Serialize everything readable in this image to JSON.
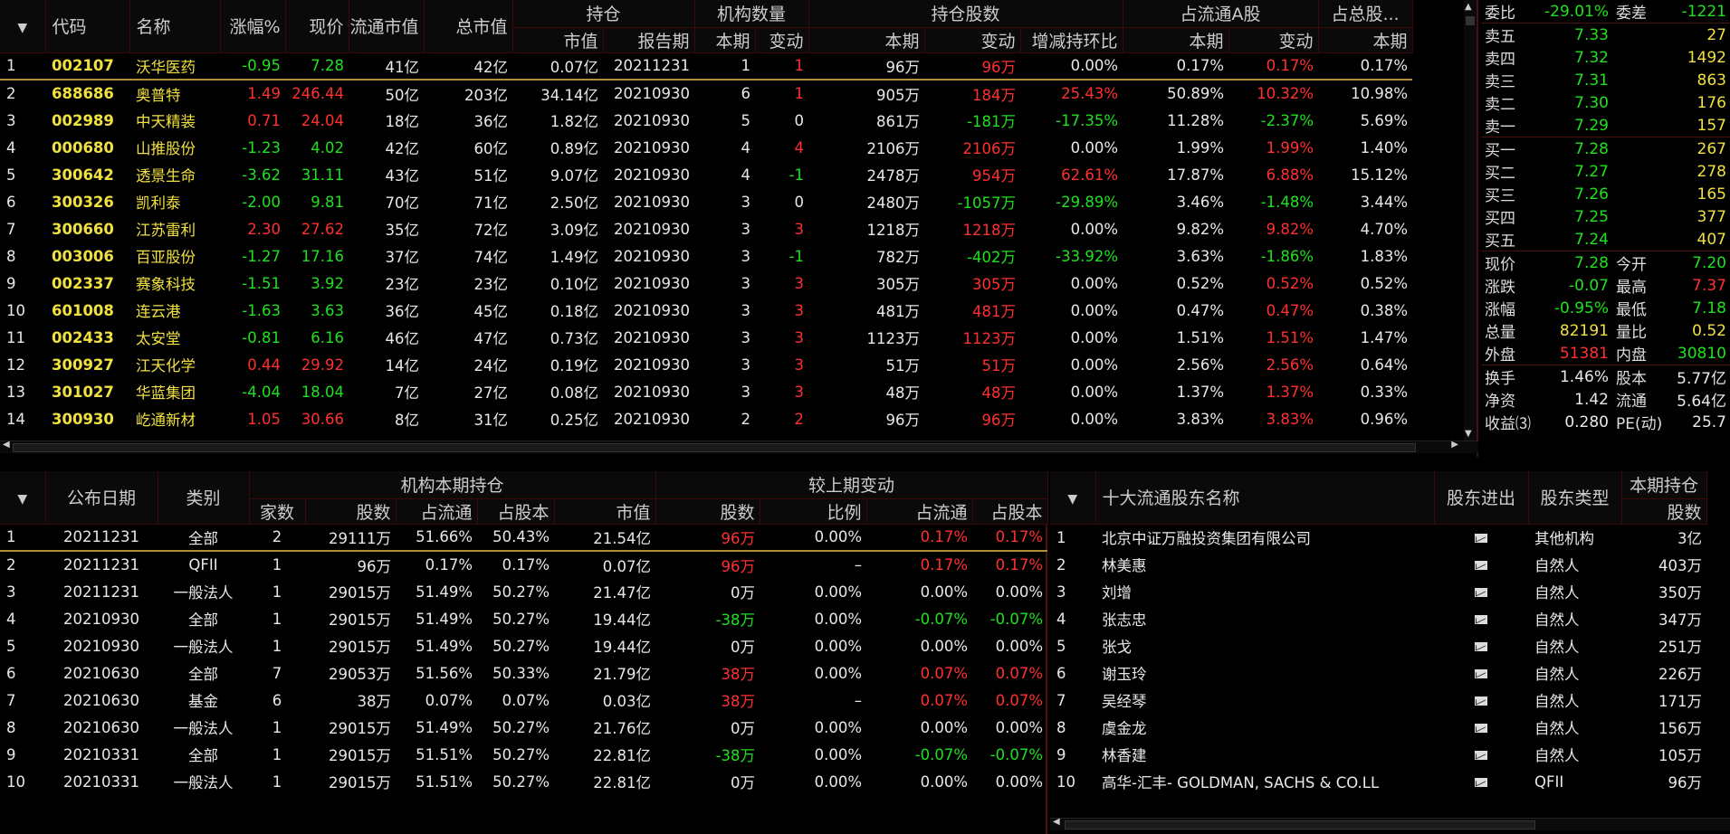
{
  "top": {
    "headers": [
      "代码",
      "名称",
      "涨幅%",
      "现价",
      "流通市值",
      "总市值",
      "持仓",
      "机构数量",
      "持仓股数",
      "占流通A股",
      "占总股..."
    ],
    "subheaders": [
      "市值",
      "报告期",
      "本期",
      "变动",
      "本期",
      "变动",
      "增减持环比",
      "本期",
      "变动",
      "本期"
    ],
    "rows": [
      {
        "n": "1",
        "code": "002107",
        "name": "沃华医药",
        "pct": "-0.95",
        "price": "7.28",
        "flt": "41亿",
        "tot": "42亿",
        "mv": "0.07亿",
        "rpt": "20211231",
        "cnt": "1",
        "chg": "1",
        "sh": "96万",
        "shchg": "96万",
        "qoq": "0.00%",
        "fa": "0.17%",
        "fachg": "0.17%",
        "ta": "0.17%",
        "c": {
          "pct": "g",
          "price": "g",
          "chg": "r",
          "shchg": "r",
          "qoq": "w",
          "fachg": "r"
        }
      },
      {
        "n": "2",
        "code": "688686",
        "name": "奥普特",
        "pct": "1.49",
        "price": "246.44",
        "flt": "50亿",
        "tot": "203亿",
        "mv": "34.14亿",
        "rpt": "20210930",
        "cnt": "6",
        "chg": "1",
        "sh": "905万",
        "shchg": "184万",
        "qoq": "25.43%",
        "fa": "50.89%",
        "fachg": "10.32%",
        "ta": "10.98%",
        "c": {
          "pct": "r",
          "price": "r",
          "chg": "r",
          "shchg": "r",
          "qoq": "r",
          "fachg": "r"
        }
      },
      {
        "n": "3",
        "code": "002989",
        "name": "中天精装",
        "pct": "0.71",
        "price": "24.04",
        "flt": "18亿",
        "tot": "36亿",
        "mv": "1.82亿",
        "rpt": "20210930",
        "cnt": "5",
        "chg": "0",
        "sh": "861万",
        "shchg": "-181万",
        "qoq": "-17.35%",
        "fa": "11.28%",
        "fachg": "-2.37%",
        "ta": "5.69%",
        "c": {
          "pct": "r",
          "price": "r",
          "chg": "w",
          "shchg": "g",
          "qoq": "g",
          "fachg": "g"
        }
      },
      {
        "n": "4",
        "code": "000680",
        "name": "山推股份",
        "pct": "-1.23",
        "price": "4.02",
        "flt": "42亿",
        "tot": "60亿",
        "mv": "0.89亿",
        "rpt": "20210930",
        "cnt": "4",
        "chg": "4",
        "sh": "2106万",
        "shchg": "2106万",
        "qoq": "0.00%",
        "fa": "1.99%",
        "fachg": "1.99%",
        "ta": "1.40%",
        "c": {
          "pct": "g",
          "price": "g",
          "chg": "r",
          "shchg": "r",
          "qoq": "w",
          "fachg": "r"
        }
      },
      {
        "n": "5",
        "code": "300642",
        "name": "透景生命",
        "pct": "-3.62",
        "price": "31.11",
        "flt": "43亿",
        "tot": "51亿",
        "mv": "9.07亿",
        "rpt": "20210930",
        "cnt": "4",
        "chg": "-1",
        "sh": "2478万",
        "shchg": "954万",
        "qoq": "62.61%",
        "fa": "17.87%",
        "fachg": "6.88%",
        "ta": "15.12%",
        "c": {
          "pct": "g",
          "price": "g",
          "chg": "g",
          "shchg": "r",
          "qoq": "r",
          "fachg": "r"
        }
      },
      {
        "n": "6",
        "code": "300326",
        "name": "凯利泰",
        "pct": "-2.00",
        "price": "9.81",
        "flt": "70亿",
        "tot": "71亿",
        "mv": "2.50亿",
        "rpt": "20210930",
        "cnt": "3",
        "chg": "0",
        "sh": "2480万",
        "shchg": "-1057万",
        "qoq": "-29.89%",
        "fa": "3.46%",
        "fachg": "-1.48%",
        "ta": "3.44%",
        "c": {
          "pct": "g",
          "price": "g",
          "chg": "w",
          "shchg": "g",
          "qoq": "g",
          "fachg": "g"
        }
      },
      {
        "n": "7",
        "code": "300660",
        "name": "江苏雷利",
        "pct": "2.30",
        "price": "27.62",
        "flt": "35亿",
        "tot": "72亿",
        "mv": "3.09亿",
        "rpt": "20210930",
        "cnt": "3",
        "chg": "3",
        "sh": "1218万",
        "shchg": "1218万",
        "qoq": "0.00%",
        "fa": "9.82%",
        "fachg": "9.82%",
        "ta": "4.70%",
        "c": {
          "pct": "r",
          "price": "r",
          "chg": "r",
          "shchg": "r",
          "qoq": "w",
          "fachg": "r"
        }
      },
      {
        "n": "8",
        "code": "003006",
        "name": "百亚股份",
        "pct": "-1.27",
        "price": "17.16",
        "flt": "37亿",
        "tot": "74亿",
        "mv": "1.49亿",
        "rpt": "20210930",
        "cnt": "3",
        "chg": "-1",
        "sh": "782万",
        "shchg": "-402万",
        "qoq": "-33.92%",
        "fa": "3.63%",
        "fachg": "-1.86%",
        "ta": "1.83%",
        "c": {
          "pct": "g",
          "price": "g",
          "chg": "g",
          "shchg": "g",
          "qoq": "g",
          "fachg": "g"
        }
      },
      {
        "n": "9",
        "code": "002337",
        "name": "赛象科技",
        "pct": "-1.51",
        "price": "3.92",
        "flt": "23亿",
        "tot": "23亿",
        "mv": "0.10亿",
        "rpt": "20210930",
        "cnt": "3",
        "chg": "3",
        "sh": "305万",
        "shchg": "305万",
        "qoq": "0.00%",
        "fa": "0.52%",
        "fachg": "0.52%",
        "ta": "0.52%",
        "c": {
          "pct": "g",
          "price": "g",
          "chg": "r",
          "shchg": "r",
          "qoq": "w",
          "fachg": "r"
        }
      },
      {
        "n": "10",
        "code": "601008",
        "name": "连云港",
        "pct": "-1.63",
        "price": "3.63",
        "flt": "36亿",
        "tot": "45亿",
        "mv": "0.18亿",
        "rpt": "20210930",
        "cnt": "3",
        "chg": "3",
        "sh": "481万",
        "shchg": "481万",
        "qoq": "0.00%",
        "fa": "0.47%",
        "fachg": "0.47%",
        "ta": "0.38%",
        "c": {
          "pct": "g",
          "price": "g",
          "chg": "r",
          "shchg": "r",
          "qoq": "w",
          "fachg": "r"
        }
      },
      {
        "n": "11",
        "code": "002433",
        "name": "太安堂",
        "pct": "-0.81",
        "price": "6.16",
        "flt": "46亿",
        "tot": "47亿",
        "mv": "0.73亿",
        "rpt": "20210930",
        "cnt": "3",
        "chg": "3",
        "sh": "1123万",
        "shchg": "1123万",
        "qoq": "0.00%",
        "fa": "1.51%",
        "fachg": "1.51%",
        "ta": "1.47%",
        "c": {
          "pct": "g",
          "price": "g",
          "chg": "r",
          "shchg": "r",
          "qoq": "w",
          "fachg": "r"
        }
      },
      {
        "n": "12",
        "code": "300927",
        "name": "江天化学",
        "pct": "0.44",
        "price": "29.92",
        "flt": "14亿",
        "tot": "24亿",
        "mv": "0.19亿",
        "rpt": "20210930",
        "cnt": "3",
        "chg": "3",
        "sh": "51万",
        "shchg": "51万",
        "qoq": "0.00%",
        "fa": "2.56%",
        "fachg": "2.56%",
        "ta": "0.64%",
        "c": {
          "pct": "r",
          "price": "r",
          "chg": "r",
          "shchg": "r",
          "qoq": "w",
          "fachg": "r"
        }
      },
      {
        "n": "13",
        "code": "301027",
        "name": "华蓝集团",
        "pct": "-4.04",
        "price": "18.04",
        "flt": "7亿",
        "tot": "27亿",
        "mv": "0.08亿",
        "rpt": "20210930",
        "cnt": "3",
        "chg": "3",
        "sh": "48万",
        "shchg": "48万",
        "qoq": "0.00%",
        "fa": "1.37%",
        "fachg": "1.37%",
        "ta": "0.33%",
        "c": {
          "pct": "g",
          "price": "g",
          "chg": "r",
          "shchg": "r",
          "qoq": "w",
          "fachg": "r"
        }
      },
      {
        "n": "14",
        "code": "300930",
        "name": "屹通新材",
        "pct": "1.05",
        "price": "30.66",
        "flt": "8亿",
        "tot": "31亿",
        "mv": "0.25亿",
        "rpt": "20210930",
        "cnt": "2",
        "chg": "2",
        "sh": "96万",
        "shchg": "96万",
        "qoq": "0.00%",
        "fa": "3.83%",
        "fachg": "3.83%",
        "ta": "0.96%",
        "c": {
          "pct": "r",
          "price": "r",
          "chg": "r",
          "shchg": "r",
          "qoq": "w",
          "fachg": "r"
        }
      }
    ]
  },
  "quote": {
    "wei": {
      "l1": "委比",
      "v1": "-29.01%",
      "l2": "委差",
      "v2": "-1221"
    },
    "asks": [
      {
        "l": "卖五",
        "p": "7.33",
        "v": "27"
      },
      {
        "l": "卖四",
        "p": "7.32",
        "v": "1492"
      },
      {
        "l": "卖三",
        "p": "7.31",
        "v": "863"
      },
      {
        "l": "卖二",
        "p": "7.30",
        "v": "176"
      },
      {
        "l": "卖一",
        "p": "7.29",
        "v": "157"
      }
    ],
    "bids": [
      {
        "l": "买一",
        "p": "7.28",
        "v": "267"
      },
      {
        "l": "买二",
        "p": "7.27",
        "v": "278"
      },
      {
        "l": "买三",
        "p": "7.26",
        "v": "165"
      },
      {
        "l": "买四",
        "p": "7.25",
        "v": "377"
      },
      {
        "l": "买五",
        "p": "7.24",
        "v": "407"
      }
    ],
    "stats1": [
      {
        "l1": "现价",
        "v1": "7.28",
        "c1": "g",
        "l2": "今开",
        "v2": "7.20",
        "c2": "g"
      },
      {
        "l1": "涨跌",
        "v1": "-0.07",
        "c1": "g",
        "l2": "最高",
        "v2": "7.37",
        "c2": "r"
      },
      {
        "l1": "涨幅",
        "v1": "-0.95%",
        "c1": "g",
        "l2": "最低",
        "v2": "7.18",
        "c2": "g"
      },
      {
        "l1": "总量",
        "v1": "82191",
        "c1": "yl",
        "l2": "量比",
        "v2": "0.52",
        "c2": "yl"
      },
      {
        "l1": "外盘",
        "v1": "51381",
        "c1": "r",
        "l2": "内盘",
        "v2": "30810",
        "c2": "g"
      }
    ],
    "stats2": [
      {
        "l1": "换手",
        "v1": "1.46%",
        "l2": "股本",
        "v2": "5.77亿"
      },
      {
        "l1": "净资",
        "v1": "1.42",
        "l2": "流通",
        "v2": "5.64亿"
      },
      {
        "l1": "收益⑶",
        "v1": "0.280",
        "l2": "PE(动)",
        "v2": "25.7"
      }
    ]
  },
  "bl": {
    "headers": [
      "公布日期",
      "类别",
      "机构本期持仓",
      "较上期变动"
    ],
    "subheaders": [
      "家数",
      "股数",
      "占流通",
      "占股本",
      "市值",
      "股数",
      "比例",
      "占流通",
      "占股本"
    ],
    "rows": [
      {
        "n": "1",
        "date": "20211231",
        "cat": "全部",
        "cnt": "2",
        "sh": "29111万",
        "pf": "51.66%",
        "pt": "50.43%",
        "mv": "21.54亿",
        "dsh": "96万",
        "ratio": "0.00%",
        "df": "0.17%",
        "dt": "0.17%",
        "c": "r"
      },
      {
        "n": "2",
        "date": "20211231",
        "cat": "QFII",
        "cnt": "1",
        "sh": "96万",
        "pf": "0.17%",
        "pt": "0.17%",
        "mv": "0.07亿",
        "dsh": "96万",
        "ratio": "–",
        "df": "0.17%",
        "dt": "0.17%",
        "c": "r"
      },
      {
        "n": "3",
        "date": "20211231",
        "cat": "一般法人",
        "cnt": "1",
        "sh": "29015万",
        "pf": "51.49%",
        "pt": "50.27%",
        "mv": "21.47亿",
        "dsh": "0万",
        "ratio": "0.00%",
        "df": "0.00%",
        "dt": "0.00%",
        "c": "w"
      },
      {
        "n": "4",
        "date": "20210930",
        "cat": "全部",
        "cnt": "1",
        "sh": "29015万",
        "pf": "51.49%",
        "pt": "50.27%",
        "mv": "19.44亿",
        "dsh": "-38万",
        "ratio": "0.00%",
        "df": "-0.07%",
        "dt": "-0.07%",
        "c": "g"
      },
      {
        "n": "5",
        "date": "20210930",
        "cat": "一般法人",
        "cnt": "1",
        "sh": "29015万",
        "pf": "51.49%",
        "pt": "50.27%",
        "mv": "19.44亿",
        "dsh": "0万",
        "ratio": "0.00%",
        "df": "0.00%",
        "dt": "0.00%",
        "c": "w"
      },
      {
        "n": "6",
        "date": "20210630",
        "cat": "全部",
        "cnt": "7",
        "sh": "29053万",
        "pf": "51.56%",
        "pt": "50.33%",
        "mv": "21.79亿",
        "dsh": "38万",
        "ratio": "0.00%",
        "df": "0.07%",
        "dt": "0.07%",
        "c": "r"
      },
      {
        "n": "7",
        "date": "20210630",
        "cat": "基金",
        "cnt": "6",
        "sh": "38万",
        "pf": "0.07%",
        "pt": "0.07%",
        "mv": "0.03亿",
        "dsh": "38万",
        "ratio": "–",
        "df": "0.07%",
        "dt": "0.07%",
        "c": "r"
      },
      {
        "n": "8",
        "date": "20210630",
        "cat": "一般法人",
        "cnt": "1",
        "sh": "29015万",
        "pf": "51.49%",
        "pt": "50.27%",
        "mv": "21.76亿",
        "dsh": "0万",
        "ratio": "0.00%",
        "df": "0.00%",
        "dt": "0.00%",
        "c": "w"
      },
      {
        "n": "9",
        "date": "20210331",
        "cat": "全部",
        "cnt": "1",
        "sh": "29015万",
        "pf": "51.51%",
        "pt": "50.27%",
        "mv": "22.81亿",
        "dsh": "-38万",
        "ratio": "0.00%",
        "df": "-0.07%",
        "dt": "-0.07%",
        "c": "g"
      },
      {
        "n": "10",
        "date": "20210331",
        "cat": "一般法人",
        "cnt": "1",
        "sh": "29015万",
        "pf": "51.51%",
        "pt": "50.27%",
        "mv": "22.81亿",
        "dsh": "0万",
        "ratio": "0.00%",
        "df": "0.00%",
        "dt": "0.00%",
        "c": "w"
      }
    ]
  },
  "br": {
    "headers": [
      "十大流通股东名称",
      "股东进出",
      "股东类型",
      "本期持仓"
    ],
    "subheaders": [
      "股数"
    ],
    "rows": [
      {
        "n": "1",
        "name": "北京中证万融投资集团有限公司",
        "type": "其他机构",
        "sh": "3亿"
      },
      {
        "n": "2",
        "name": "林美惠",
        "type": "自然人",
        "sh": "403万"
      },
      {
        "n": "3",
        "name": "刘增",
        "type": "自然人",
        "sh": "350万"
      },
      {
        "n": "4",
        "name": "张志忠",
        "type": "自然人",
        "sh": "347万"
      },
      {
        "n": "5",
        "name": "张戈",
        "type": "自然人",
        "sh": "251万"
      },
      {
        "n": "6",
        "name": "谢玉玲",
        "type": "自然人",
        "sh": "226万"
      },
      {
        "n": "7",
        "name": "吴经琴",
        "type": "自然人",
        "sh": "171万"
      },
      {
        "n": "8",
        "name": "虞金龙",
        "type": "自然人",
        "sh": "156万"
      },
      {
        "n": "9",
        "name": "林香建",
        "type": "自然人",
        "sh": "105万"
      },
      {
        "n": "10",
        "name": "高华-汇丰- GOLDMAN, SACHS & CO.LL",
        "type": "QFII",
        "sh": "96万"
      }
    ]
  },
  "colors": {
    "red": "#ff3030",
    "green": "#20e020",
    "yellow": "#f0e040",
    "border": "#4a1010"
  }
}
